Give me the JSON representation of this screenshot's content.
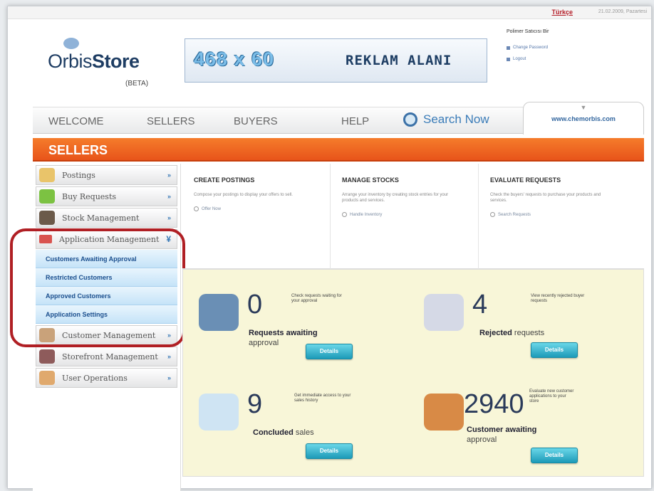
{
  "topbar": {
    "language": "Türkçe",
    "datetime": "21.02.2009, Pazartesi"
  },
  "header": {
    "logo_prefix": "Orbis",
    "logo_bold": "Store",
    "beta": "(BETA)",
    "banner_size": "468 x 60",
    "banner_label": "REKLAM ALANI"
  },
  "user": {
    "name": "Polimer Satıcısı Bir",
    "links": [
      "Change Password",
      "Logout"
    ]
  },
  "nav": {
    "items": [
      "WELCOME",
      "SELLERS",
      "BUYERS",
      "HELP"
    ],
    "search": "Search Now",
    "site": "www.chemorbis.com"
  },
  "section_title": "SELLERS",
  "sidebar": {
    "items": [
      {
        "label": "Postings"
      },
      {
        "label": "Buy Requests"
      },
      {
        "label": "Stock Management"
      },
      {
        "label": "Application Management"
      },
      {
        "label": "Customer Management"
      },
      {
        "label": "Storefront Management"
      },
      {
        "label": "User Operations"
      }
    ],
    "subitems": [
      "Customers Awaiting Approval",
      "Restricted Customers",
      "Approved Customers",
      "Application Settings"
    ]
  },
  "columns": [
    {
      "title": "CREATE POSTINGS",
      "text": "Compose your postings to display your offers to sell.",
      "link": "Offer Now"
    },
    {
      "title": "MANAGE STOCKS",
      "text": "Arrange your inventory by creating stock entries for your products and services.",
      "link": "Handle Inventory"
    },
    {
      "title": "EVALUATE REQUESTS",
      "text": "Check the buyers' requests to purchase your products and services.",
      "link": "Search Requests"
    }
  ],
  "stats": [
    {
      "value": "0",
      "bold": "Requests awaiting",
      "rest": "approval",
      "desc": "Check requests waiting for your approval",
      "button": "Details"
    },
    {
      "value": "4",
      "bold": "Rejected",
      "rest": "requests",
      "desc": "View recently rejected buyer requests",
      "button": "Details"
    },
    {
      "value": "9",
      "bold": "Concluded",
      "rest": "sales",
      "desc": "Get immediate access to your sales history",
      "button": "Details"
    },
    {
      "value": "2940",
      "bold": "Customer awaiting",
      "rest": "approval",
      "desc": "Evaluate new customer applications to your store",
      "button": "Details"
    }
  ],
  "colors": {
    "accent": "#e8541a",
    "highlight": "#b01f24",
    "panel": "#f8f6d8",
    "button": "#1d9ab8"
  }
}
